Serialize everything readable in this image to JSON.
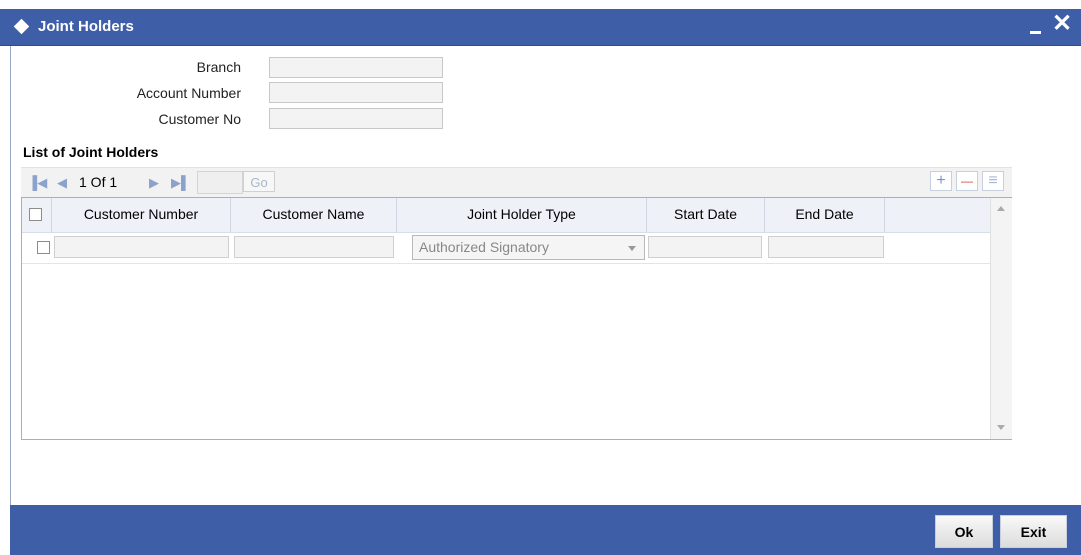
{
  "window": {
    "title": "Joint Holders",
    "minimize_icon": "minimize-icon",
    "close_glyph": "✕"
  },
  "form": {
    "branch_label": "Branch",
    "account_number_label": "Account Number",
    "customer_no_label": "Customer No",
    "branch_value": "",
    "account_number_value": "",
    "customer_no_value": ""
  },
  "section": {
    "title": "List of Joint Holders"
  },
  "pager": {
    "first_glyph": "▐◀",
    "prev_glyph": "◀",
    "text": "1 Of 1",
    "next_glyph": "▶",
    "last_glyph": "▶▌",
    "go_label": "Go",
    "goto_value": ""
  },
  "toolbar": {
    "add_glyph": "+",
    "delete_glyph": "—",
    "view_glyph": "≡"
  },
  "grid": {
    "columns": [
      "Customer Number",
      "Customer Name",
      "Joint Holder Type",
      "Start Date",
      "End Date"
    ],
    "rows": [
      {
        "customer_number": "",
        "customer_name": "",
        "joint_holder_type": "Authorized Signatory",
        "start_date": "",
        "end_date": ""
      }
    ]
  },
  "buttons": {
    "ok": "Ok",
    "exit": "Exit"
  },
  "colors": {
    "titlebar": "#3e5fa8",
    "footer": "#3e5fa8"
  }
}
